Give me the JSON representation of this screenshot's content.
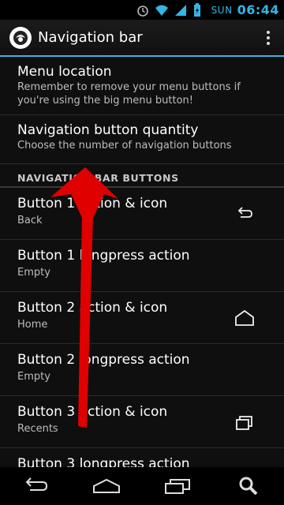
{
  "status_bar": {
    "day": "SUN",
    "time": "06:44"
  },
  "action_bar": {
    "title": "Navigation bar"
  },
  "prefs": [
    {
      "title": "Menu location",
      "summary": "Remember to remove your menu buttons if you're using the big menu button!"
    },
    {
      "title": "Navigation button quantity",
      "summary": "Choose the number of navigation buttons"
    }
  ],
  "section": {
    "header": "NAVIGATION BAR BUTTONS"
  },
  "buttons": [
    {
      "title": "Button 1 action & icon",
      "summary": "Back",
      "icon": "back-icon"
    },
    {
      "title": "Button 1 longpress action",
      "summary": "Empty"
    },
    {
      "title": "Button 2 action & icon",
      "summary": "Home",
      "icon": "home-icon"
    },
    {
      "title": "Button 2 longpress action",
      "summary": "Empty"
    },
    {
      "title": "Button 3 action & icon",
      "summary": "Recents",
      "icon": "recents-icon"
    },
    {
      "title": "Button 3 longpress action",
      "summary": ""
    }
  ],
  "colors": {
    "accent": "#33b5e5",
    "arrow": "#e00000"
  }
}
